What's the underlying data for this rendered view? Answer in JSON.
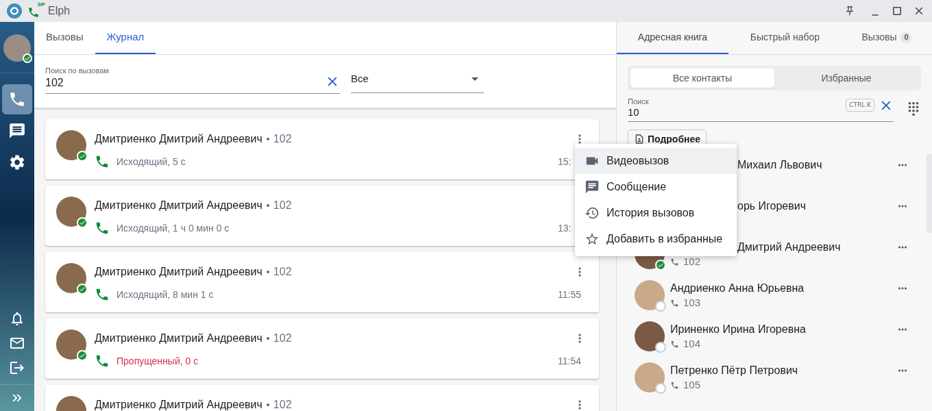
{
  "window": {
    "title": "Elph",
    "badge": "SIP"
  },
  "user": {
    "online": true
  },
  "nav": {
    "top": [
      {
        "kind": "phone",
        "selected": true
      },
      {
        "kind": "message",
        "selected": false
      },
      {
        "kind": "settings",
        "selected": false
      }
    ],
    "bottom": [
      {
        "kind": "notifications"
      },
      {
        "kind": "mail"
      },
      {
        "kind": "logout"
      }
    ]
  },
  "main_tabs": [
    {
      "label": "Вызовы",
      "selected": false
    },
    {
      "label": "Журнал",
      "selected": true
    }
  ],
  "call_search": {
    "label": "Поиск по вызовам",
    "value": "102"
  },
  "filter": {
    "value": "Все"
  },
  "calls": [
    {
      "name": "Дмитриенко Дмитрий Андреевич",
      "ext": "102",
      "online": true,
      "kind": "outgoing",
      "detail": "Исходящий, 5 с",
      "time": "15:"
    },
    {
      "name": "Дмитриенко Дмитрий Андреевич",
      "ext": "102",
      "online": true,
      "kind": "outgoing",
      "detail": "Исходящий, 1 ч 0 мин 0 с",
      "time": "13:"
    },
    {
      "name": "Дмитриенко Дмитрий Андреевич",
      "ext": "102",
      "online": true,
      "kind": "outgoing",
      "detail": "Исходящий, 8 мин 1 с",
      "time": "11:55"
    },
    {
      "name": "Дмитриенко Дмитрий Андреевич",
      "ext": "102",
      "online": true,
      "kind": "missed",
      "detail": "Пропущенный, 0 с",
      "time": "11:54"
    },
    {
      "name": "Дмитриенко Дмитрий Андреевич",
      "ext": "102"
    }
  ],
  "side_tabs": [
    {
      "label": "Адресная книга",
      "selected": true
    },
    {
      "label": "Быстрый набор",
      "selected": false
    },
    {
      "label": "Вызовы",
      "selected": false,
      "badge": "0"
    }
  ],
  "segments": [
    {
      "label": "Все контакты",
      "selected": true
    },
    {
      "label": "Избранные",
      "selected": false
    }
  ],
  "contact_search": {
    "label": "Поиск",
    "value": "10",
    "shortcut": "CTRL K"
  },
  "details_button": "Подробнее",
  "contacts": [
    {
      "name": "Михаил Львович",
      "under_menu": true
    },
    {
      "name": "орь Игоревич",
      "under_menu": true
    },
    {
      "name": "Дмитрий Андреевич",
      "under_menu": true,
      "ext": "102",
      "online": true
    },
    {
      "name": "Андриенко Анна Юрьевна",
      "under_menu": false,
      "ext": "103",
      "online": false
    },
    {
      "name": "Ириненко Ирина Игоревна",
      "under_menu": false,
      "ext": "104",
      "online": false
    },
    {
      "name": "Петренко Пётр Петрович",
      "under_menu": false,
      "ext": "105",
      "online": false
    }
  ],
  "menu": [
    {
      "kind": "video",
      "label": "Видеовызов",
      "selected": true
    },
    {
      "kind": "message",
      "label": "Сообщение",
      "selected": false
    },
    {
      "kind": "history",
      "label": "История вызовов",
      "selected": false
    },
    {
      "kind": "favorite",
      "label": "Добавить в избранные",
      "selected": false
    }
  ]
}
